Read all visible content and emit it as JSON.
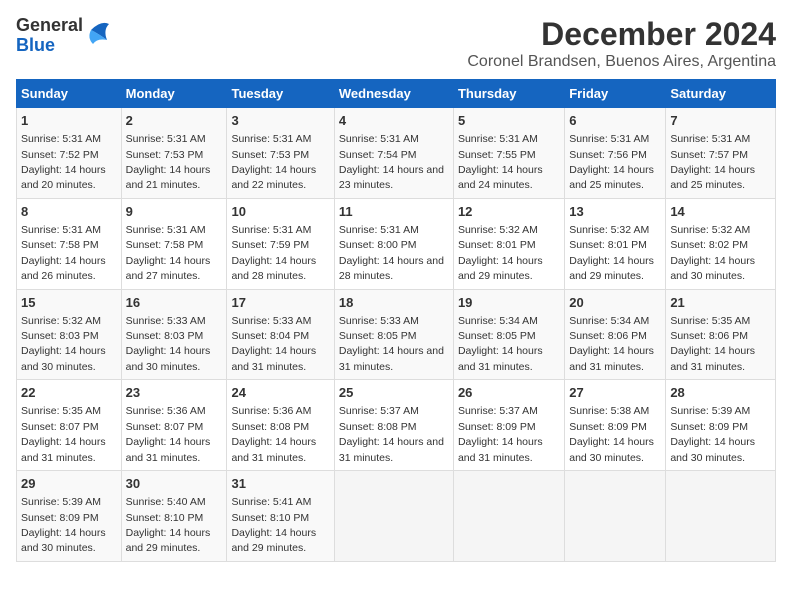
{
  "logo": {
    "text_general": "General",
    "text_blue": "Blue"
  },
  "title": "December 2024",
  "subtitle": "Coronel Brandsen, Buenos Aires, Argentina",
  "days_of_week": [
    "Sunday",
    "Monday",
    "Tuesday",
    "Wednesday",
    "Thursday",
    "Friday",
    "Saturday"
  ],
  "weeks": [
    [
      {
        "day": "1",
        "sunrise": "Sunrise: 5:31 AM",
        "sunset": "Sunset: 7:52 PM",
        "daylight": "Daylight: 14 hours and 20 minutes."
      },
      {
        "day": "2",
        "sunrise": "Sunrise: 5:31 AM",
        "sunset": "Sunset: 7:53 PM",
        "daylight": "Daylight: 14 hours and 21 minutes."
      },
      {
        "day": "3",
        "sunrise": "Sunrise: 5:31 AM",
        "sunset": "Sunset: 7:53 PM",
        "daylight": "Daylight: 14 hours and 22 minutes."
      },
      {
        "day": "4",
        "sunrise": "Sunrise: 5:31 AM",
        "sunset": "Sunset: 7:54 PM",
        "daylight": "Daylight: 14 hours and 23 minutes."
      },
      {
        "day": "5",
        "sunrise": "Sunrise: 5:31 AM",
        "sunset": "Sunset: 7:55 PM",
        "daylight": "Daylight: 14 hours and 24 minutes."
      },
      {
        "day": "6",
        "sunrise": "Sunrise: 5:31 AM",
        "sunset": "Sunset: 7:56 PM",
        "daylight": "Daylight: 14 hours and 25 minutes."
      },
      {
        "day": "7",
        "sunrise": "Sunrise: 5:31 AM",
        "sunset": "Sunset: 7:57 PM",
        "daylight": "Daylight: 14 hours and 25 minutes."
      }
    ],
    [
      {
        "day": "8",
        "sunrise": "Sunrise: 5:31 AM",
        "sunset": "Sunset: 7:58 PM",
        "daylight": "Daylight: 14 hours and 26 minutes."
      },
      {
        "day": "9",
        "sunrise": "Sunrise: 5:31 AM",
        "sunset": "Sunset: 7:58 PM",
        "daylight": "Daylight: 14 hours and 27 minutes."
      },
      {
        "day": "10",
        "sunrise": "Sunrise: 5:31 AM",
        "sunset": "Sunset: 7:59 PM",
        "daylight": "Daylight: 14 hours and 28 minutes."
      },
      {
        "day": "11",
        "sunrise": "Sunrise: 5:31 AM",
        "sunset": "Sunset: 8:00 PM",
        "daylight": "Daylight: 14 hours and 28 minutes."
      },
      {
        "day": "12",
        "sunrise": "Sunrise: 5:32 AM",
        "sunset": "Sunset: 8:01 PM",
        "daylight": "Daylight: 14 hours and 29 minutes."
      },
      {
        "day": "13",
        "sunrise": "Sunrise: 5:32 AM",
        "sunset": "Sunset: 8:01 PM",
        "daylight": "Daylight: 14 hours and 29 minutes."
      },
      {
        "day": "14",
        "sunrise": "Sunrise: 5:32 AM",
        "sunset": "Sunset: 8:02 PM",
        "daylight": "Daylight: 14 hours and 30 minutes."
      }
    ],
    [
      {
        "day": "15",
        "sunrise": "Sunrise: 5:32 AM",
        "sunset": "Sunset: 8:03 PM",
        "daylight": "Daylight: 14 hours and 30 minutes."
      },
      {
        "day": "16",
        "sunrise": "Sunrise: 5:33 AM",
        "sunset": "Sunset: 8:03 PM",
        "daylight": "Daylight: 14 hours and 30 minutes."
      },
      {
        "day": "17",
        "sunrise": "Sunrise: 5:33 AM",
        "sunset": "Sunset: 8:04 PM",
        "daylight": "Daylight: 14 hours and 31 minutes."
      },
      {
        "day": "18",
        "sunrise": "Sunrise: 5:33 AM",
        "sunset": "Sunset: 8:05 PM",
        "daylight": "Daylight: 14 hours and 31 minutes."
      },
      {
        "day": "19",
        "sunrise": "Sunrise: 5:34 AM",
        "sunset": "Sunset: 8:05 PM",
        "daylight": "Daylight: 14 hours and 31 minutes."
      },
      {
        "day": "20",
        "sunrise": "Sunrise: 5:34 AM",
        "sunset": "Sunset: 8:06 PM",
        "daylight": "Daylight: 14 hours and 31 minutes."
      },
      {
        "day": "21",
        "sunrise": "Sunrise: 5:35 AM",
        "sunset": "Sunset: 8:06 PM",
        "daylight": "Daylight: 14 hours and 31 minutes."
      }
    ],
    [
      {
        "day": "22",
        "sunrise": "Sunrise: 5:35 AM",
        "sunset": "Sunset: 8:07 PM",
        "daylight": "Daylight: 14 hours and 31 minutes."
      },
      {
        "day": "23",
        "sunrise": "Sunrise: 5:36 AM",
        "sunset": "Sunset: 8:07 PM",
        "daylight": "Daylight: 14 hours and 31 minutes."
      },
      {
        "day": "24",
        "sunrise": "Sunrise: 5:36 AM",
        "sunset": "Sunset: 8:08 PM",
        "daylight": "Daylight: 14 hours and 31 minutes."
      },
      {
        "day": "25",
        "sunrise": "Sunrise: 5:37 AM",
        "sunset": "Sunset: 8:08 PM",
        "daylight": "Daylight: 14 hours and 31 minutes."
      },
      {
        "day": "26",
        "sunrise": "Sunrise: 5:37 AM",
        "sunset": "Sunset: 8:09 PM",
        "daylight": "Daylight: 14 hours and 31 minutes."
      },
      {
        "day": "27",
        "sunrise": "Sunrise: 5:38 AM",
        "sunset": "Sunset: 8:09 PM",
        "daylight": "Daylight: 14 hours and 30 minutes."
      },
      {
        "day": "28",
        "sunrise": "Sunrise: 5:39 AM",
        "sunset": "Sunset: 8:09 PM",
        "daylight": "Daylight: 14 hours and 30 minutes."
      }
    ],
    [
      {
        "day": "29",
        "sunrise": "Sunrise: 5:39 AM",
        "sunset": "Sunset: 8:09 PM",
        "daylight": "Daylight: 14 hours and 30 minutes."
      },
      {
        "day": "30",
        "sunrise": "Sunrise: 5:40 AM",
        "sunset": "Sunset: 8:10 PM",
        "daylight": "Daylight: 14 hours and 29 minutes."
      },
      {
        "day": "31",
        "sunrise": "Sunrise: 5:41 AM",
        "sunset": "Sunset: 8:10 PM",
        "daylight": "Daylight: 14 hours and 29 minutes."
      },
      null,
      null,
      null,
      null
    ]
  ]
}
